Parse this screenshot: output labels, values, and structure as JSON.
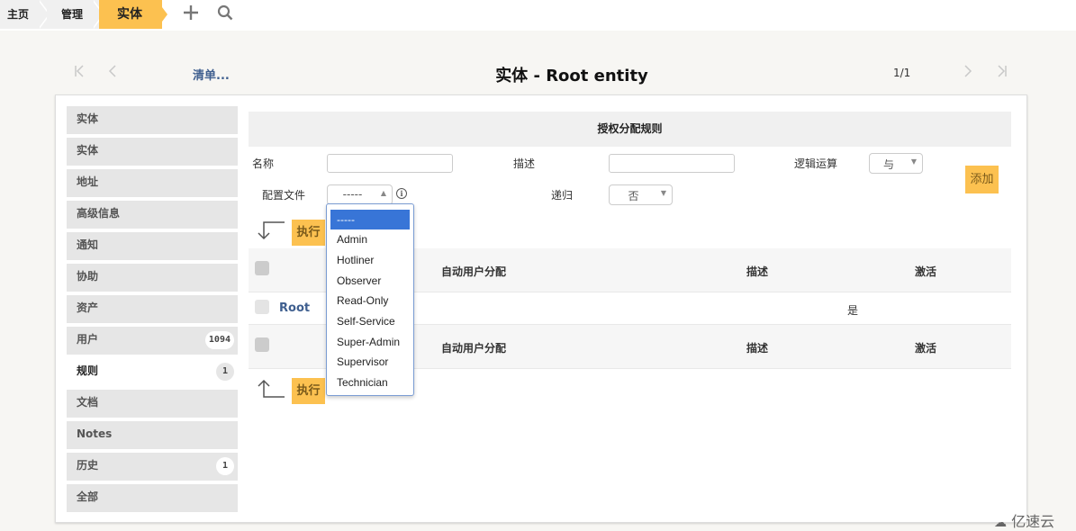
{
  "breadcrumb": {
    "items": [
      "主页",
      "管理",
      "实体"
    ],
    "add_icon": "plus-icon",
    "search_icon": "search-icon"
  },
  "header": {
    "first_icon": "first-page-icon",
    "prev_icon": "prev-page-icon",
    "list_link": "清单...",
    "title": "实体 - Root entity",
    "pager": "1/1",
    "next_icon": "next-page-icon",
    "last_icon": "last-page-icon"
  },
  "sidebar": {
    "items": [
      {
        "label": "实体",
        "badge": null
      },
      {
        "label": "实体",
        "badge": null
      },
      {
        "label": "地址",
        "badge": null
      },
      {
        "label": "高级信息",
        "badge": null
      },
      {
        "label": "通知",
        "badge": null
      },
      {
        "label": "协助",
        "badge": null
      },
      {
        "label": "资产",
        "badge": null
      },
      {
        "label": "用户",
        "badge": "1094"
      },
      {
        "label": "规则",
        "badge": "1",
        "active": true
      },
      {
        "label": "文档",
        "badge": null
      },
      {
        "label": "Notes",
        "badge": null
      },
      {
        "label": "历史",
        "badge": "1"
      },
      {
        "label": "全部",
        "badge": null
      }
    ]
  },
  "form": {
    "section_title": "授权分配规则",
    "name_label": "名称",
    "name_value": "",
    "desc_label": "描述",
    "desc_value": "",
    "logic_label": "逻辑运算",
    "logic_value": "与",
    "profile_label": "配置文件",
    "profile_value": "-----",
    "recursive_label": "递归",
    "recursive_value": "否",
    "add_button": "添加"
  },
  "profile_dropdown": {
    "options": [
      "-----",
      "Admin",
      "Hotliner",
      "Observer",
      "Read-Only",
      "Self-Service",
      "Super-Admin",
      "Supervisor",
      "Technician"
    ],
    "selected_index": 0
  },
  "actions": {
    "execute_label": "执行"
  },
  "table": {
    "columns": [
      "自动用户分配",
      "描述",
      "激活"
    ],
    "rows": [
      {
        "name": "Root",
        "auto_assign": "",
        "description": "",
        "active": "是"
      }
    ]
  },
  "watermark": "亿速云",
  "colors": {
    "accent": "#fcc150",
    "link": "#3f5f8f",
    "dropdown_selected": "#3875d7"
  }
}
